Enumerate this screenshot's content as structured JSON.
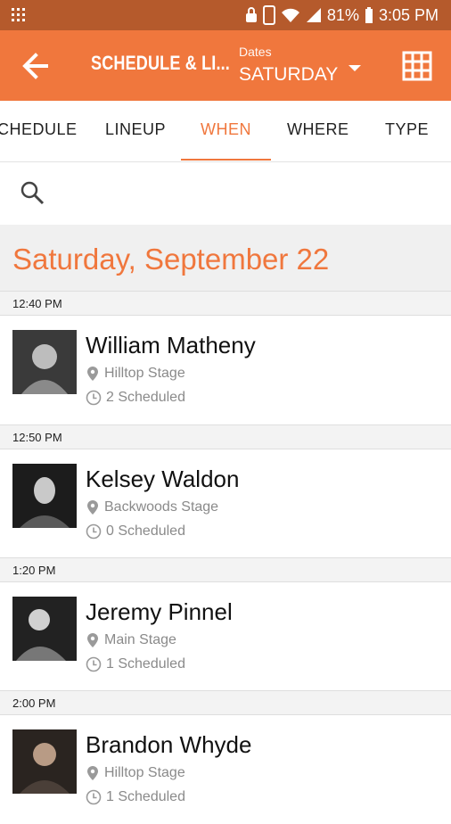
{
  "status": {
    "signal": "81%",
    "time": "3:05 PM"
  },
  "appbar": {
    "title": "SCHEDULE & LI...",
    "dates_label": "Dates",
    "dates_value": "SATURDAY"
  },
  "tabs": [
    {
      "label": "CHEDULE"
    },
    {
      "label": "LINEUP"
    },
    {
      "label": "WHEN"
    },
    {
      "label": "WHERE"
    },
    {
      "label": "TYPE"
    }
  ],
  "day_title": "Saturday, September 22",
  "events": [
    {
      "time": "12:40 PM",
      "artist": "William Matheny",
      "stage": "Hilltop Stage",
      "scheduled": "2 Scheduled"
    },
    {
      "time": "12:50 PM",
      "artist": "Kelsey Waldon",
      "stage": "Backwoods Stage",
      "scheduled": "0 Scheduled"
    },
    {
      "time": "1:20 PM",
      "artist": "Jeremy Pinnel",
      "stage": "Main Stage",
      "scheduled": "1 Scheduled"
    },
    {
      "time": "2:00 PM",
      "artist": "Brandon Whyde",
      "stage": "Hilltop Stage",
      "scheduled": "1 Scheduled"
    }
  ],
  "colors": {
    "accent": "#f0773d",
    "statusbar": "#b55a2c"
  }
}
